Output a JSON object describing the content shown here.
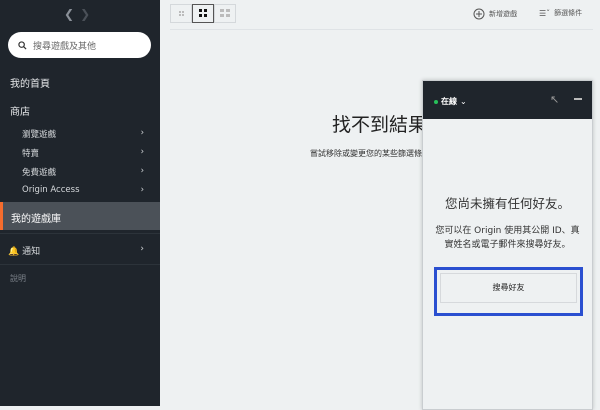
{
  "sidebar": {
    "search_placeholder": "搜尋遊戲及其他",
    "home": "我的首頁",
    "store": "商店",
    "store_items": [
      {
        "label": "瀏覽遊戲"
      },
      {
        "label": "特賣"
      },
      {
        "label": "免費遊戲"
      },
      {
        "label": "Origin Access"
      }
    ],
    "library": "我的遊戲庫",
    "notifications": "通知",
    "help": "說明"
  },
  "toolbar": {
    "add_game": "新增遊戲",
    "filter": "篩選條件"
  },
  "main": {
    "empty_title": "找不到結果",
    "empty_subtitle": "嘗試移除或變更您的某些篩選條件"
  },
  "friends": {
    "status": "在線",
    "title": "您尚未擁有任何好友。",
    "description": "您可以在 Origin 使用其公開 ID、真實姓名或電子郵件來搜尋好友。",
    "search_button": "搜尋好友"
  },
  "colors": {
    "accent": "#f56c2d",
    "online": "#27c15a",
    "highlight": "#2a4fd0"
  }
}
